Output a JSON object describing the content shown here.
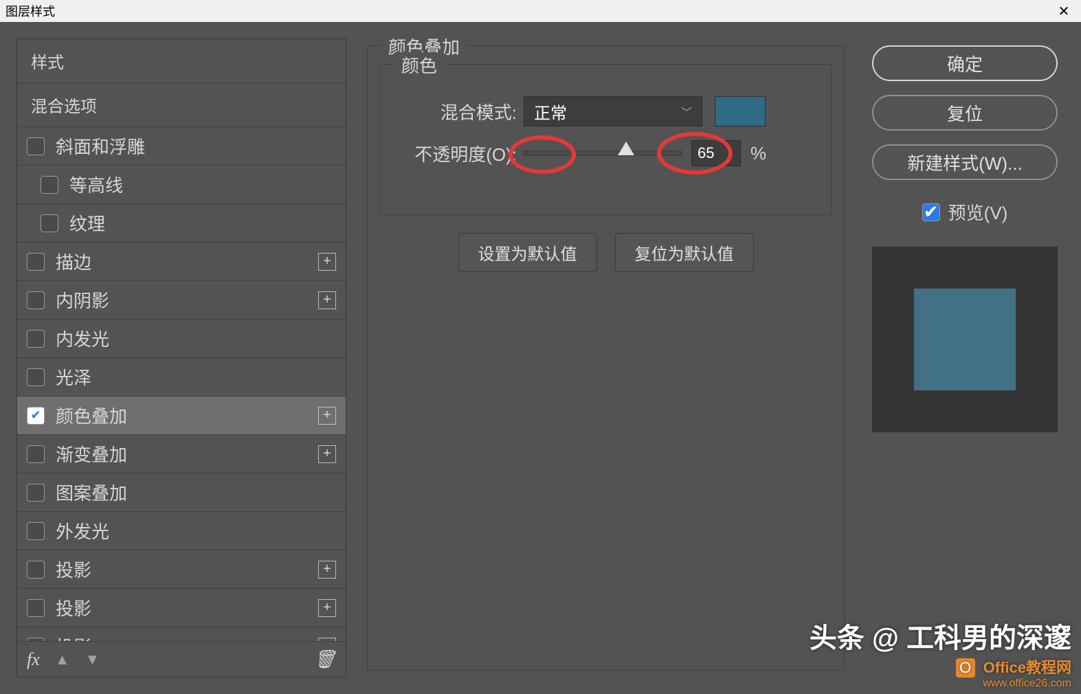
{
  "window": {
    "title": "图层样式",
    "close_glyph": "✕"
  },
  "left": {
    "header": "样式",
    "blending": "混合选项",
    "items": [
      {
        "label": "斜面和浮雕",
        "checked": false,
        "plus": false,
        "sub": false
      },
      {
        "label": "等高线",
        "checked": false,
        "plus": false,
        "sub": true
      },
      {
        "label": "纹理",
        "checked": false,
        "plus": false,
        "sub": true
      },
      {
        "label": "描边",
        "checked": false,
        "plus": true,
        "sub": false
      },
      {
        "label": "内阴影",
        "checked": false,
        "plus": true,
        "sub": false
      },
      {
        "label": "内发光",
        "checked": false,
        "plus": false,
        "sub": false
      },
      {
        "label": "光泽",
        "checked": false,
        "plus": false,
        "sub": false
      },
      {
        "label": "颜色叠加",
        "checked": true,
        "plus": true,
        "sub": false,
        "selected": true
      },
      {
        "label": "渐变叠加",
        "checked": false,
        "plus": true,
        "sub": false
      },
      {
        "label": "图案叠加",
        "checked": false,
        "plus": false,
        "sub": false
      },
      {
        "label": "外发光",
        "checked": false,
        "plus": false,
        "sub": false
      },
      {
        "label": "投影",
        "checked": false,
        "plus": true,
        "sub": false
      },
      {
        "label": "投影",
        "checked": false,
        "plus": true,
        "sub": false
      },
      {
        "label": "投影",
        "checked": false,
        "plus": true,
        "sub": false
      }
    ],
    "footer": {
      "fx": "fx",
      "up": "▲",
      "down": "▼",
      "trash": "🗑"
    }
  },
  "center": {
    "group_title": "颜色叠加",
    "color_section": "颜色",
    "blend_label": "混合模式:",
    "blend_value": "正常",
    "color_swatch": "#2d6b86",
    "opacity_label": "不透明度(O):",
    "opacity_value": "65",
    "opacity_pct": "%",
    "btn_default": "设置为默认值",
    "btn_reset_default": "复位为默认值"
  },
  "right": {
    "ok": "确定",
    "reset": "复位",
    "new_style": "新建样式(W)...",
    "preview_label": "预览(V)",
    "preview_checked": true,
    "preview_color": "#427186"
  },
  "watermark": {
    "line1": "头条 @ 工科男的深邃",
    "line2": "Office教程网",
    "line3": "www.office26.com",
    "logo": "O"
  }
}
